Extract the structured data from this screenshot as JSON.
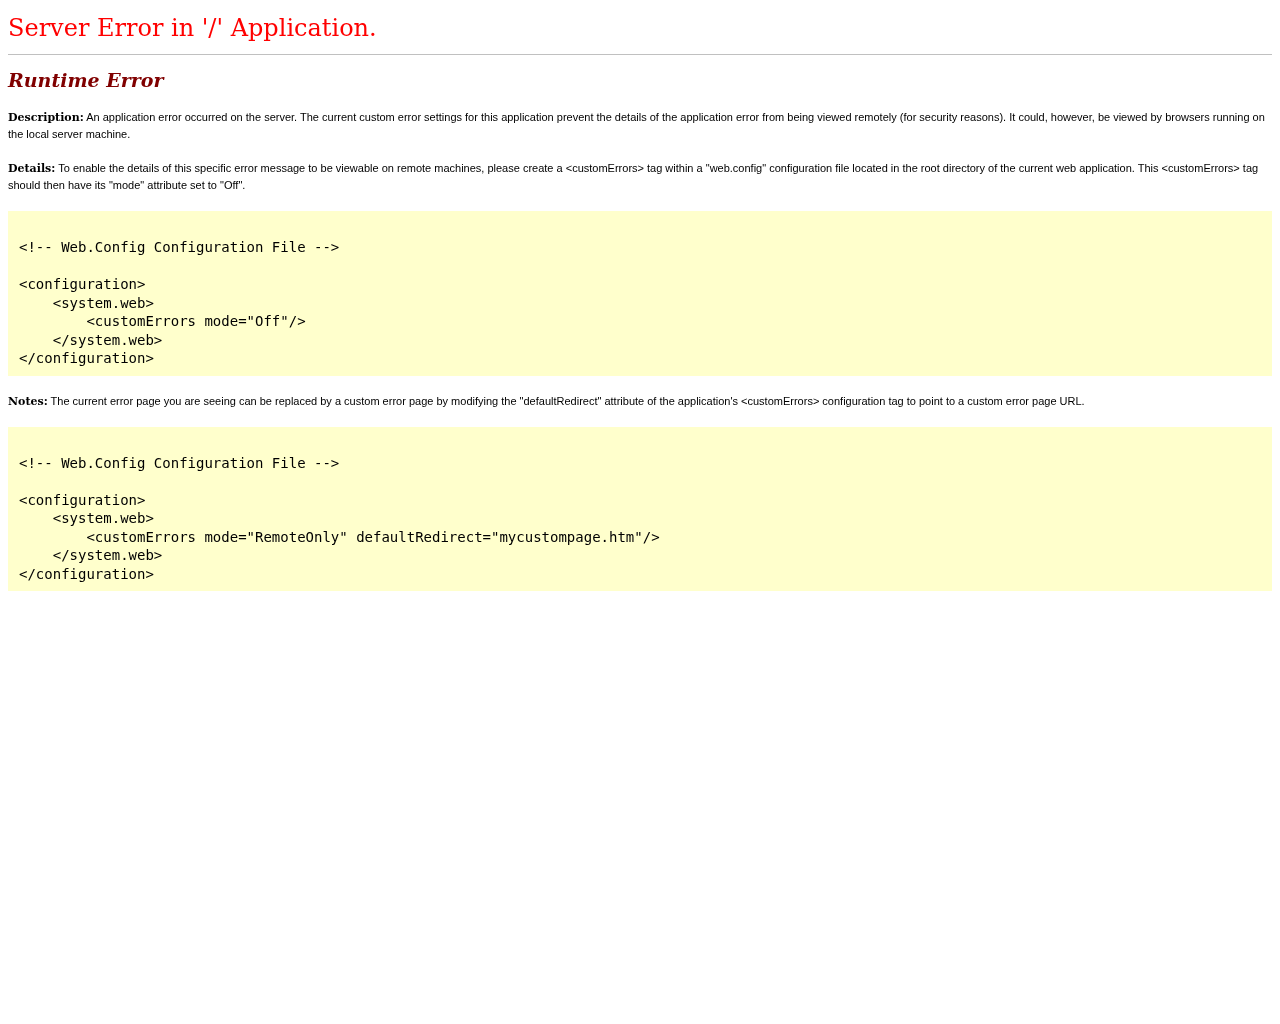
{
  "title": "Server Error in '/' Application.",
  "subtitle": "Runtime Error",
  "sections": [
    {
      "kind": "paragraph",
      "label": "Description:",
      "text": "An application error occurred on the server. The current custom error settings for this application prevent the details of the application error from being viewed remotely (for security reasons). It could, however, be viewed by browsers running on the local server machine."
    },
    {
      "kind": "paragraph",
      "label": "Details:",
      "text": "To enable the details of this specific error message to be viewable on remote machines, please create a <customErrors> tag within a \"web.config\" configuration file located in the root directory of the current web application. This <customErrors> tag should then have its \"mode\" attribute set to \"Off\"."
    },
    {
      "kind": "code",
      "code": "<!-- Web.Config Configuration File -->\n\n<configuration>\n    <system.web>\n        <customErrors mode=\"Off\"/>\n    </system.web>\n</configuration>"
    },
    {
      "kind": "paragraph",
      "label": "Notes:",
      "text": "The current error page you are seeing can be replaced by a custom error page by modifying the \"defaultRedirect\" attribute of the application's <customErrors> configuration tag to point to a custom error page URL."
    },
    {
      "kind": "code",
      "code": "<!-- Web.Config Configuration File -->\n\n<configuration>\n    <system.web>\n        <customErrors mode=\"RemoteOnly\" defaultRedirect=\"mycustompage.htm\"/>\n    </system.web>\n</configuration>"
    }
  ]
}
